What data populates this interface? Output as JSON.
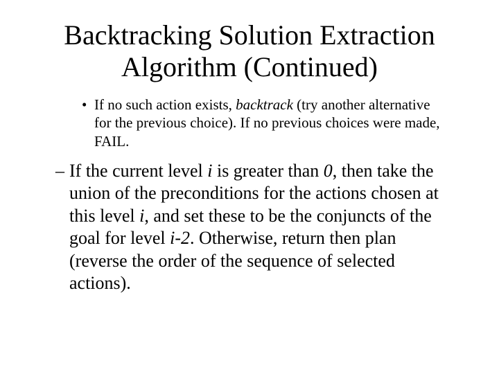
{
  "title": "Backtracking Solution Extraction Algorithm (Continued)",
  "bullet1": {
    "pre": "If no such action exists, ",
    "em": "backtrack",
    "post": " (try another alternative for the previous choice).  If no previous choices were made, FAIL."
  },
  "bullet2": {
    "a": "If the current level ",
    "i1": "i",
    "b": " is greater than ",
    "zero": "0",
    "c": ", then take the union of the preconditions for the actions chosen at this level ",
    "i2": "i",
    "d": ", and set these to be the conjuncts of the goal for level ",
    "i3": "i-2",
    "e": ".  Otherwise, return then plan (reverse the order of the sequence of selected actions)."
  },
  "marks": {
    "dot": "•",
    "dash": "–"
  }
}
